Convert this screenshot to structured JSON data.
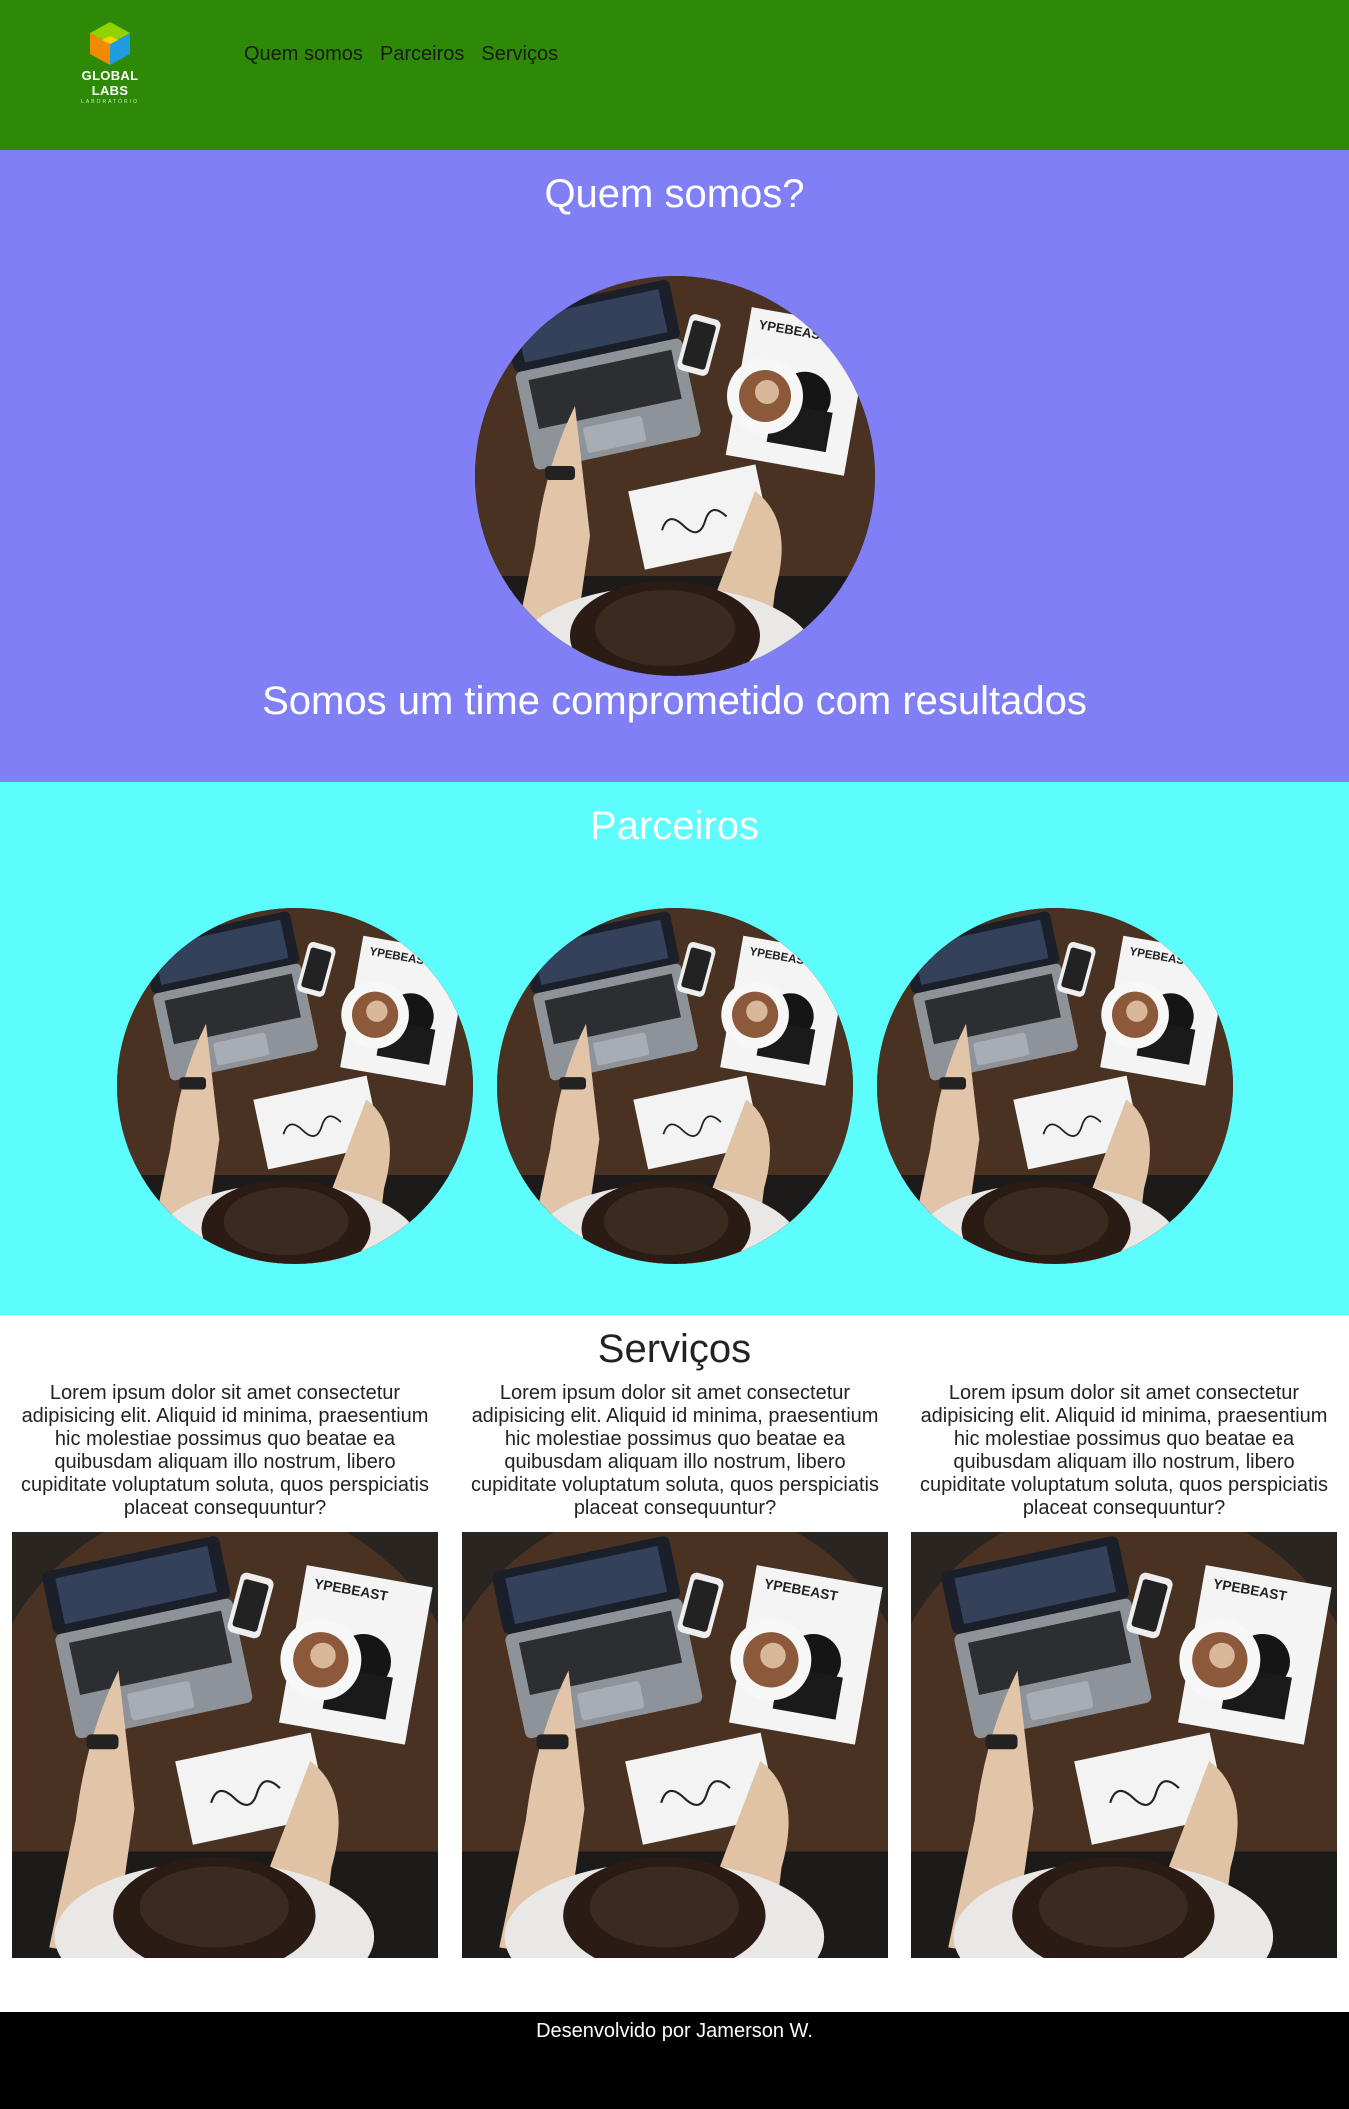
{
  "header": {
    "logo_text": "GLOBAL LABS",
    "logo_sub": "LABORATÓRIO",
    "nav": [
      {
        "label": "Quem somos"
      },
      {
        "label": "Parceiros"
      },
      {
        "label": "Serviços"
      }
    ]
  },
  "quem": {
    "title": "Quem somos?",
    "tagline": "Somos um time comprometido com resultados"
  },
  "parceiros": {
    "title": "Parceiros"
  },
  "servicos": {
    "title": "Serviços",
    "items": [
      {
        "text": "Lorem ipsum dolor sit amet consectetur adipisicing elit. Aliquid id minima, praesentium hic molestiae possimus quo beatae ea quibusdam aliquam illo nostrum, libero cupiditate voluptatum soluta, quos perspiciatis placeat consequuntur?"
      },
      {
        "text": "Lorem ipsum dolor sit amet consectetur adipisicing elit. Aliquid id minima, praesentium hic molestiae possimus quo beatae ea quibusdam aliquam illo nostrum, libero cupiditate voluptatum soluta, quos perspiciatis placeat consequuntur?"
      },
      {
        "text": "Lorem ipsum dolor sit amet consectetur adipisicing elit. Aliquid id minima, praesentium hic molestiae possimus quo beatae ea quibusdam aliquam illo nostrum, libero cupiditate voluptatum soluta, quos perspiciatis placeat consequuntur?"
      }
    ]
  },
  "footer": {
    "text": "Desenvolvido por Jamerson W."
  },
  "colors": {
    "header_bg": "#2e8a06",
    "quem_bg": "#807ff5",
    "parceiros_bg": "#5cfdfc",
    "footer_bg": "#000000"
  }
}
